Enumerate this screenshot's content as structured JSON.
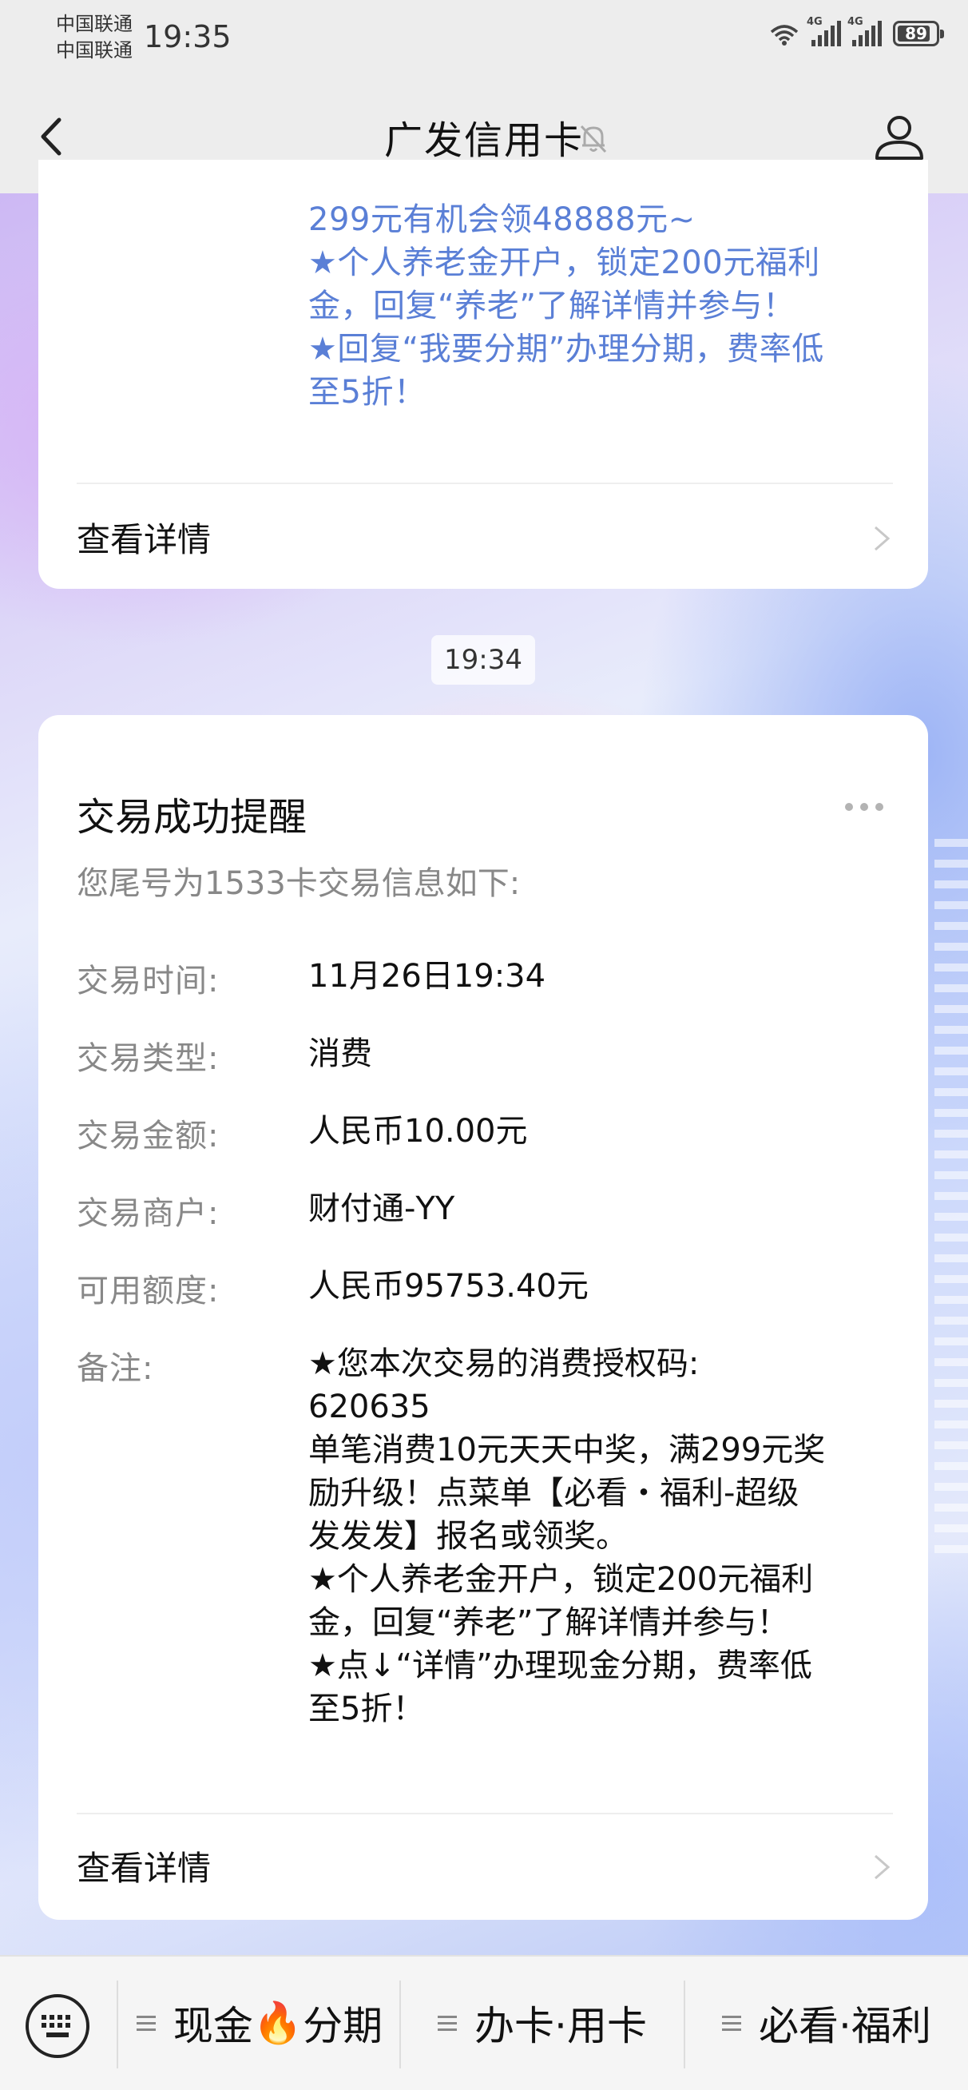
{
  "status_bar": {
    "carrier1": "中国联通",
    "carrier2": "中国联通",
    "time": "19:35",
    "network1": "4G",
    "network2": "4G",
    "battery": "89"
  },
  "nav": {
    "title": "广发信用卡"
  },
  "message1": {
    "lines": [
      "299元有机会领48888元~",
      "★个人养老金开户，锁定200元福利",
      "金，回复“养老”了解详情并参与！",
      "★回复“我要分期”办理分期，费率低",
      "至5折！"
    ],
    "detail_label": "查看详情"
  },
  "timestamp": "19:34",
  "message2": {
    "title": "交易成功提醒",
    "subtitle": "您尾号为1533卡交易信息如下:",
    "rows": [
      {
        "label": "交易时间:",
        "value": "11月26日19:34"
      },
      {
        "label": "交易类型:",
        "value": "消费"
      },
      {
        "label": "交易金额:",
        "value": "人民币10.00元"
      },
      {
        "label": "交易商户:",
        "value": "财付通-YY"
      },
      {
        "label": "可用额度:",
        "value": "人民币95753.40元"
      }
    ],
    "remark_label": "备注:",
    "remark_lines": [
      "★您本次交易的消费授权码:",
      "620635",
      "单笔消费10元天天中奖，满299元奖",
      "励升级！点菜单【必看・福利-超级",
      "发发发】报名或领奖。",
      "★个人养老金开户，锁定200元福利",
      "金，回复“养老”了解详情并参与！",
      "★点↓“详情”办理现金分期，费率低",
      "至5折！"
    ],
    "detail_label": "查看详情"
  },
  "bottom_menu": {
    "item1_a": "现金",
    "item1_emoji": "🔥",
    "item1_b": "分期",
    "item2": "办卡·用卡",
    "item3": "必看·福利"
  },
  "colors": {
    "accent_blue": "#5a7fd6",
    "bar_gray": "#ededed"
  }
}
